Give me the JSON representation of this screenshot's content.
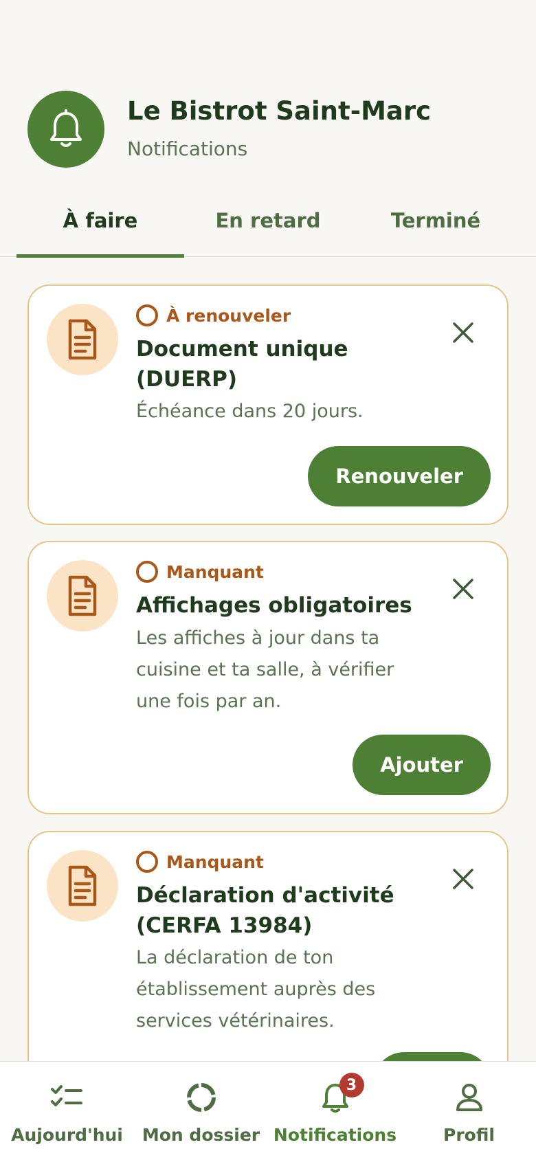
{
  "header": {
    "title": "Le Bistrot Saint-Marc",
    "subtitle": "Notifications",
    "avatar_icon": "bell-icon"
  },
  "tabs": [
    {
      "label": "À faire",
      "active": true
    },
    {
      "label": "En retard",
      "active": false
    },
    {
      "label": "Terminé",
      "active": false
    }
  ],
  "cards": [
    {
      "icon": "document-icon",
      "status": "À renouveler",
      "title": "Document unique (DUERP)",
      "description": "Échéance dans 20 jours.",
      "action": "Renouveler"
    },
    {
      "icon": "document-icon",
      "status": "Manquant",
      "title": "Affichages obligatoires",
      "description": "Les affiches à jour dans ta cuisine et ta salle, à vérifier une fois par an.",
      "action": "Ajouter"
    },
    {
      "icon": "document-icon",
      "status": "Manquant",
      "title": "Déclaration d'activité (CERFA 13984)",
      "description": "La déclaration de ton établissement auprès des services vétérinaires."
    }
  ],
  "bottom_nav": [
    {
      "label": "Aujourd'hui",
      "icon": "checklist-icon"
    },
    {
      "label": "Mon dossier",
      "icon": "progress-ring-icon"
    },
    {
      "label": "Notifications",
      "icon": "bell-icon",
      "badge": "3",
      "active": true
    },
    {
      "label": "Profil",
      "icon": "user-icon"
    }
  ],
  "colors": {
    "primary": "#4d7f34",
    "accent_orange": "#a8581a",
    "card_border": "#e8c48d",
    "badge": "#b23a2e",
    "background": "#f8f7f3"
  }
}
